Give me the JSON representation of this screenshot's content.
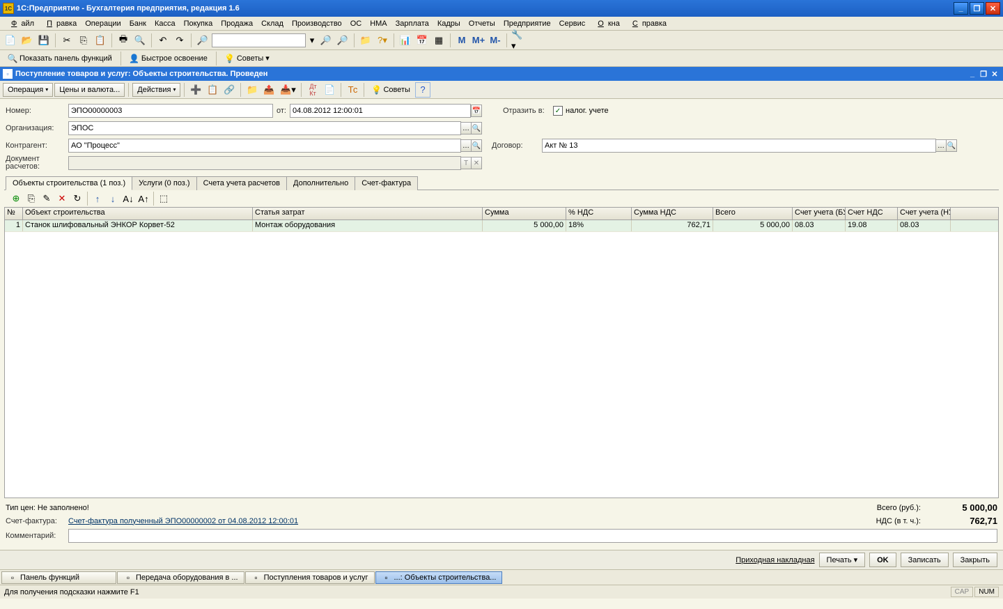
{
  "app_title": "1С:Предприятие - Бухгалтерия предприятия, редакция 1.6",
  "menu": [
    "Файл",
    "Правка",
    "Операции",
    "Банк",
    "Касса",
    "Покупка",
    "Продажа",
    "Склад",
    "Производство",
    "ОС",
    "НМА",
    "Зарплата",
    "Кадры",
    "Отчеты",
    "Предприятие",
    "Сервис",
    "Окна",
    "Справка"
  ],
  "menu_ul": [
    "Ф",
    "П",
    "",
    "",
    "",
    "",
    "",
    "",
    "",
    "",
    "",
    "",
    "",
    "",
    "",
    "",
    "О",
    "С"
  ],
  "sec_toolbar": {
    "panel": "Показать панель функций",
    "quick": "Быстрое освоение",
    "tips": "Советы"
  },
  "doc_title": "Поступление товаров и услуг: Объекты строительства. Проведен",
  "doc_toolbar": {
    "operation": "Операция",
    "prices": "Цены и валюта...",
    "actions": "Действия",
    "tips": "Советы"
  },
  "labels": {
    "number": "Номер:",
    "from": "от:",
    "org": "Организация:",
    "contr": "Контрагент:",
    "settle": "Документ расчетов:",
    "reflect": "Отразить в:",
    "tax": "налог. учете",
    "contract": "Договор:"
  },
  "form": {
    "number": "ЭПО00000003",
    "date": "04.08.2012 12:00:01",
    "org": "ЭПОС",
    "contragent": "АО \"Процесс\"",
    "contract": "Акт № 13",
    "settlement": ""
  },
  "tabs": [
    "Объекты строительства (1 поз.)",
    "Услуги (0 поз.)",
    "Счета учета расчетов",
    "Дополнительно",
    "Счет-фактура"
  ],
  "active_tab": 0,
  "grid": {
    "columns": [
      "№",
      "Объект строительства",
      "Статья затрат",
      "Сумма",
      "% НДС",
      "Сумма НДС",
      "Всего",
      "Счет учета (БУ)",
      "Счет НДС",
      "Счет учета (НУ)"
    ],
    "widths": [
      26,
      330,
      330,
      120,
      94,
      117,
      114,
      76,
      75,
      76
    ],
    "rows": [
      {
        "n": "1",
        "obj": "Станок шлифовальный ЭНКОР Корвет-52",
        "cost": "Монтаж оборудования",
        "sum": "5 000,00",
        "vatpct": "18%",
        "vatsum": "762,71",
        "total": "5 000,00",
        "acc_bu": "08.03",
        "acc_vat": "19.08",
        "acc_nu": "08.03"
      }
    ]
  },
  "bottom": {
    "price_type": "Тип цен: Не заполнено!",
    "invoice_label": "Счет-фактура:",
    "invoice_link": "Счет-фактура полученный ЭПО00000002 от 04.08.2012 12:00:01",
    "comment_label": "Комментарий:",
    "total_label": "Всего (руб.):",
    "total_value": "5 000,00",
    "vat_label": "НДС (в т. ч.):",
    "vat_value": "762,71"
  },
  "footer": {
    "slip": "Приходная накладная",
    "print": "Печать",
    "ok": "OK",
    "save": "Записать",
    "close": "Закрыть"
  },
  "taskbar": [
    "Панель функций",
    "Передача оборудования в ...",
    "Поступления товаров и услуг",
    "...: Объекты строительства..."
  ],
  "active_task": 3,
  "status": {
    "hint": "Для получения подсказки нажмите F1",
    "cap": "CAP",
    "num": "NUM"
  }
}
